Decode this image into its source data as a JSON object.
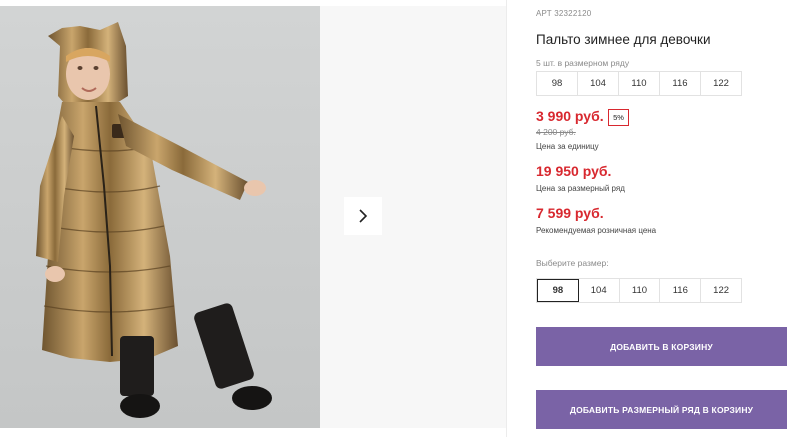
{
  "product": {
    "article": "АРТ 32322120",
    "title": "Пальто зимнее для девочки"
  },
  "size_row": {
    "hint": "5 шт. в размерном ряду",
    "sizes": [
      "98",
      "104",
      "110",
      "116",
      "122"
    ]
  },
  "prices": {
    "unit_price": "3 990 руб.",
    "discount": "5%",
    "old_price": "4 200 руб.",
    "unit_label": "Цена за единицу",
    "row_price": "19 950 руб.",
    "row_label": "Цена за размерный ряд",
    "retail_price": "7 599 руб.",
    "retail_label": "Рекомендуемая розничная цена"
  },
  "size_select": {
    "label": "Выберите размер:",
    "selected": "98",
    "sizes": [
      "98",
      "104",
      "110",
      "116",
      "122"
    ]
  },
  "buttons": {
    "add_to_cart": "ДОБАВИТЬ В КОРЗИНУ",
    "add_row_to_cart": "ДОБАВИТЬ РАЗМЕРНЫЙ РЯД В КОРЗИНУ"
  },
  "colors": {
    "price_red": "#d8282f",
    "button_purple": "#7a63a6"
  },
  "icons": {
    "gallery_next": "chevron-right-icon"
  }
}
